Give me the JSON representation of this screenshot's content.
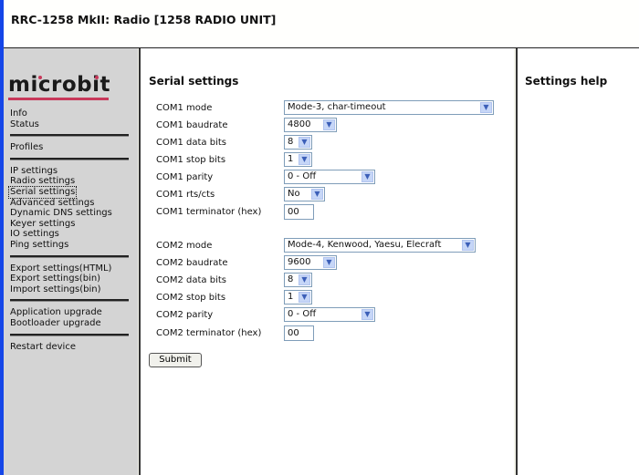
{
  "window": {
    "title": "RRC-1258 MkII: Radio [1258 RADIO UNIT]"
  },
  "brand": {
    "logo_text": "microbit",
    "accent_color": "#c8385a"
  },
  "sidebar": {
    "groups": [
      [
        {
          "label": "Info"
        },
        {
          "label": "Status"
        }
      ],
      [
        {
          "label": "Profiles"
        }
      ],
      [
        {
          "label": "IP settings"
        },
        {
          "label": "Radio settings"
        },
        {
          "label": "Serial settings",
          "active": true
        },
        {
          "label": "Advanced settings"
        },
        {
          "label": "Dynamic DNS settings"
        },
        {
          "label": "Keyer settings"
        },
        {
          "label": "IO settings"
        },
        {
          "label": "Ping settings"
        }
      ],
      [
        {
          "label": "Export settings(HTML)"
        },
        {
          "label": "Export settings(bin)"
        },
        {
          "label": "Import settings(bin)"
        }
      ],
      [
        {
          "label": "Application upgrade"
        },
        {
          "label": "Bootloader upgrade"
        }
      ],
      [
        {
          "label": "Restart device"
        }
      ]
    ]
  },
  "main": {
    "heading": "Serial settings",
    "com1": {
      "mode_label": "COM1 mode",
      "mode_value": "Mode-3, char-timeout",
      "baud_label": "COM1 baudrate",
      "baud_value": "4800",
      "databits_label": "COM1 data bits",
      "databits_value": "8",
      "stopbits_label": "COM1 stop bits",
      "stopbits_value": "1",
      "parity_label": "COM1 parity",
      "parity_value": "0 - Off",
      "rtscts_label": "COM1 rts/cts",
      "rtscts_value": "No",
      "term_label": "COM1 terminator (hex)",
      "term_value": "00"
    },
    "com2": {
      "mode_label": "COM2 mode",
      "mode_value": "Mode-4, Kenwood, Yaesu, Elecraft",
      "baud_label": "COM2 baudrate",
      "baud_value": "9600",
      "databits_label": "COM2 data bits",
      "databits_value": "8",
      "stopbits_label": "COM2 stop bits",
      "stopbits_value": "1",
      "parity_label": "COM2 parity",
      "parity_value": "0 - Off",
      "term_label": "COM2 terminator (hex)",
      "term_value": "00"
    },
    "submit_label": "Submit"
  },
  "help": {
    "heading": "Settings help"
  }
}
